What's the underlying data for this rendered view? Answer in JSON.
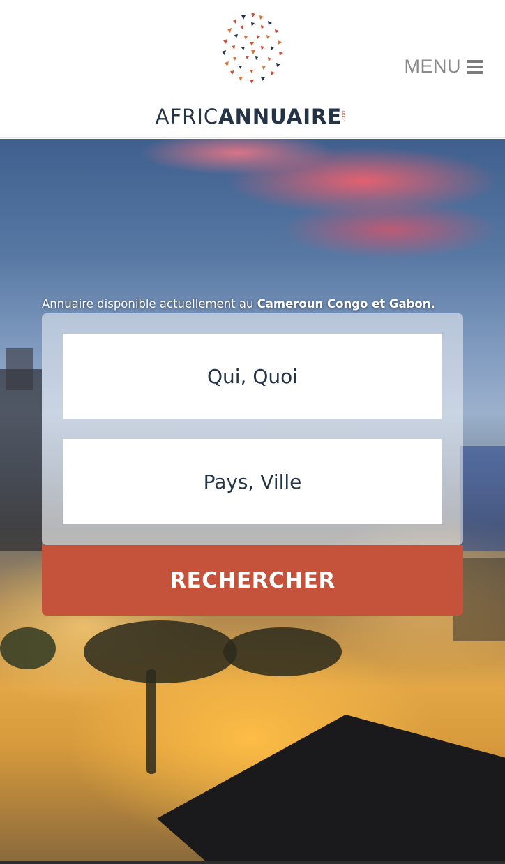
{
  "header": {
    "logo_alt": "AfricAnnuaire logo",
    "brand_light": "AFRIC",
    "brand_bold": "ANNUAIRE",
    "brand_suffix": ".com",
    "menu_label": "MENU",
    "menu_icon": "hamburger-icon"
  },
  "hero": {
    "tagline_prefix": "Annuaire disponible actuellement au ",
    "tagline_bold": "Cameroun Congo et Gabon",
    "tagline_suffix": "."
  },
  "search": {
    "what_placeholder": "Qui, Quoi",
    "where_placeholder": "Pays, Ville",
    "button_label": "RECHERCHER"
  },
  "colors": {
    "brand_dark": "#243447",
    "accent_red": "#c5533b",
    "menu_gray": "#8a8a8a"
  }
}
